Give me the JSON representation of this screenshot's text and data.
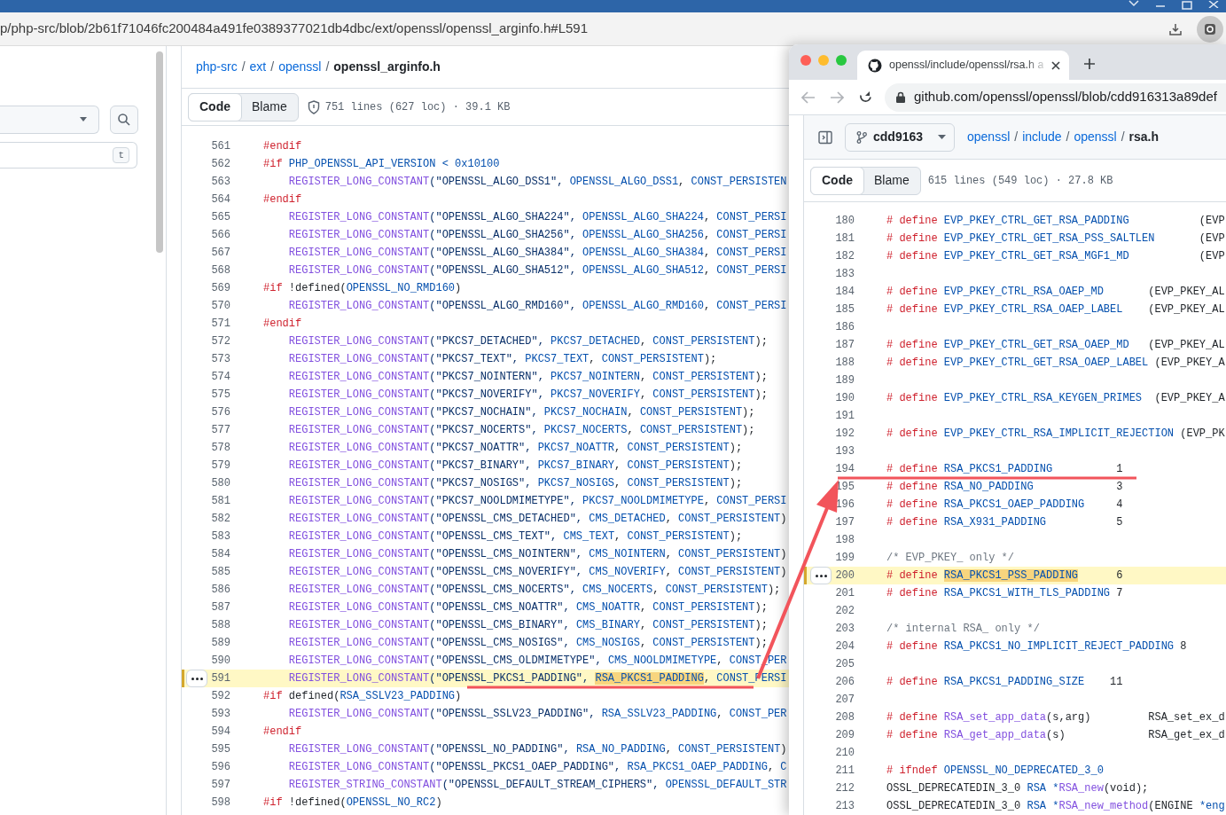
{
  "back_window": {
    "address": "p/php-src/blob/2b61f71046fc200484a491fe0389377021db4dbc/ext/openssl/openssl_arginfo.h#L591",
    "sidebar": {
      "shortcut_key": "t"
    },
    "breadcrumb": [
      {
        "kind": "link",
        "text": "php-src"
      },
      {
        "kind": "separator",
        "text": "/"
      },
      {
        "kind": "link",
        "text": "ext"
      },
      {
        "kind": "separator",
        "text": "/"
      },
      {
        "kind": "link",
        "text": "openssl"
      },
      {
        "kind": "separator",
        "text": "/"
      },
      {
        "kind": "current",
        "text": "openssl_arginfo.h"
      }
    ],
    "file_tabs": [
      {
        "label": "Code",
        "selected": true
      },
      {
        "label": "Blame",
        "selected": false
      }
    ],
    "file_info": "751 lines (627 loc) · 39.1 KB",
    "code_lines": [
      {
        "number": "561",
        "indented": false,
        "selected": false,
        "tokens": [
          {
            "kind": "kw",
            "text": "#endif"
          }
        ]
      },
      {
        "number": "562",
        "indented": false,
        "selected": false,
        "tokens": [
          {
            "kind": "kw",
            "text": "#if "
          },
          {
            "kind": "const",
            "text": "PHP_OPENSSL_API_VERSION < 0x10100"
          }
        ]
      },
      {
        "number": "563",
        "indented": true,
        "selected": false,
        "tokens": [
          {
            "kind": "fn",
            "text": "REGISTER_LONG_CONSTANT"
          },
          {
            "kind": "str",
            "text": "(\"OPENSSL_ALGO_DSS1\", "
          },
          {
            "kind": "const",
            "text": "OPENSSL_ALGO_DSS1"
          },
          {
            "kind": "plain",
            "text": ", "
          },
          {
            "kind": "const",
            "text": "CONST_PERSISTEN"
          }
        ]
      },
      {
        "number": "564",
        "indented": false,
        "selected": false,
        "tokens": [
          {
            "kind": "kw",
            "text": "#endif"
          }
        ]
      },
      {
        "number": "565",
        "indented": true,
        "selected": false,
        "tokens": [
          {
            "kind": "fn",
            "text": "REGISTER_LONG_CONSTANT"
          },
          {
            "kind": "str",
            "text": "(\"OPENSSL_ALGO_SHA224\", "
          },
          {
            "kind": "const",
            "text": "OPENSSL_ALGO_SHA224"
          },
          {
            "kind": "plain",
            "text": ", "
          },
          {
            "kind": "const",
            "text": "CONST_PERSI"
          }
        ]
      },
      {
        "number": "566",
        "indented": true,
        "selected": false,
        "tokens": [
          {
            "kind": "fn",
            "text": "REGISTER_LONG_CONSTANT"
          },
          {
            "kind": "str",
            "text": "(\"OPENSSL_ALGO_SHA256\", "
          },
          {
            "kind": "const",
            "text": "OPENSSL_ALGO_SHA256"
          },
          {
            "kind": "plain",
            "text": ", "
          },
          {
            "kind": "const",
            "text": "CONST_PERSI"
          }
        ]
      },
      {
        "number": "567",
        "indented": true,
        "selected": false,
        "tokens": [
          {
            "kind": "fn",
            "text": "REGISTER_LONG_CONSTANT"
          },
          {
            "kind": "str",
            "text": "(\"OPENSSL_ALGO_SHA384\", "
          },
          {
            "kind": "const",
            "text": "OPENSSL_ALGO_SHA384"
          },
          {
            "kind": "plain",
            "text": ", "
          },
          {
            "kind": "const",
            "text": "CONST_PERSI"
          }
        ]
      },
      {
        "number": "568",
        "indented": true,
        "selected": false,
        "tokens": [
          {
            "kind": "fn",
            "text": "REGISTER_LONG_CONSTANT"
          },
          {
            "kind": "str",
            "text": "(\"OPENSSL_ALGO_SHA512\", "
          },
          {
            "kind": "const",
            "text": "OPENSSL_ALGO_SHA512"
          },
          {
            "kind": "plain",
            "text": ", "
          },
          {
            "kind": "const",
            "text": "CONST_PERSI"
          }
        ]
      },
      {
        "number": "569",
        "indented": false,
        "selected": false,
        "tokens": [
          {
            "kind": "kw",
            "text": "#if"
          },
          {
            "kind": "plain",
            "text": " !defined("
          },
          {
            "kind": "const",
            "text": "OPENSSL_NO_RMD160"
          },
          {
            "kind": "plain",
            "text": ")"
          }
        ]
      },
      {
        "number": "570",
        "indented": true,
        "selected": false,
        "tokens": [
          {
            "kind": "fn",
            "text": "REGISTER_LONG_CONSTANT"
          },
          {
            "kind": "str",
            "text": "(\"OPENSSL_ALGO_RMD160\", "
          },
          {
            "kind": "const",
            "text": "OPENSSL_ALGO_RMD160"
          },
          {
            "kind": "plain",
            "text": ", "
          },
          {
            "kind": "const",
            "text": "CONST_PERSI"
          }
        ]
      },
      {
        "number": "571",
        "indented": false,
        "selected": false,
        "tokens": [
          {
            "kind": "kw",
            "text": "#endif"
          }
        ]
      },
      {
        "number": "572",
        "indented": true,
        "selected": false,
        "tokens": [
          {
            "kind": "fn",
            "text": "REGISTER_LONG_CONSTANT"
          },
          {
            "kind": "str",
            "text": "(\"PKCS7_DETACHED\", "
          },
          {
            "kind": "const",
            "text": "PKCS7_DETACHED"
          },
          {
            "kind": "plain",
            "text": ", "
          },
          {
            "kind": "const",
            "text": "CONST_PERSISTENT"
          },
          {
            "kind": "plain",
            "text": ");"
          }
        ]
      },
      {
        "number": "573",
        "indented": true,
        "selected": false,
        "tokens": [
          {
            "kind": "fn",
            "text": "REGISTER_LONG_CONSTANT"
          },
          {
            "kind": "str",
            "text": "(\"PKCS7_TEXT\", "
          },
          {
            "kind": "const",
            "text": "PKCS7_TEXT"
          },
          {
            "kind": "plain",
            "text": ", "
          },
          {
            "kind": "const",
            "text": "CONST_PERSISTENT"
          },
          {
            "kind": "plain",
            "text": ");"
          }
        ]
      },
      {
        "number": "574",
        "indented": true,
        "selected": false,
        "tokens": [
          {
            "kind": "fn",
            "text": "REGISTER_LONG_CONSTANT"
          },
          {
            "kind": "str",
            "text": "(\"PKCS7_NOINTERN\", "
          },
          {
            "kind": "const",
            "text": "PKCS7_NOINTERN"
          },
          {
            "kind": "plain",
            "text": ", "
          },
          {
            "kind": "const",
            "text": "CONST_PERSISTENT"
          },
          {
            "kind": "plain",
            "text": ");"
          }
        ]
      },
      {
        "number": "575",
        "indented": true,
        "selected": false,
        "tokens": [
          {
            "kind": "fn",
            "text": "REGISTER_LONG_CONSTANT"
          },
          {
            "kind": "str",
            "text": "(\"PKCS7_NOVERIFY\", "
          },
          {
            "kind": "const",
            "text": "PKCS7_NOVERIFY"
          },
          {
            "kind": "plain",
            "text": ", "
          },
          {
            "kind": "const",
            "text": "CONST_PERSISTENT"
          },
          {
            "kind": "plain",
            "text": ");"
          }
        ]
      },
      {
        "number": "576",
        "indented": true,
        "selected": false,
        "tokens": [
          {
            "kind": "fn",
            "text": "REGISTER_LONG_CONSTANT"
          },
          {
            "kind": "str",
            "text": "(\"PKCS7_NOCHAIN\", "
          },
          {
            "kind": "const",
            "text": "PKCS7_NOCHAIN"
          },
          {
            "kind": "plain",
            "text": ", "
          },
          {
            "kind": "const",
            "text": "CONST_PERSISTENT"
          },
          {
            "kind": "plain",
            "text": ");"
          }
        ]
      },
      {
        "number": "577",
        "indented": true,
        "selected": false,
        "tokens": [
          {
            "kind": "fn",
            "text": "REGISTER_LONG_CONSTANT"
          },
          {
            "kind": "str",
            "text": "(\"PKCS7_NOCERTS\", "
          },
          {
            "kind": "const",
            "text": "PKCS7_NOCERTS"
          },
          {
            "kind": "plain",
            "text": ", "
          },
          {
            "kind": "const",
            "text": "CONST_PERSISTENT"
          },
          {
            "kind": "plain",
            "text": ");"
          }
        ]
      },
      {
        "number": "578",
        "indented": true,
        "selected": false,
        "tokens": [
          {
            "kind": "fn",
            "text": "REGISTER_LONG_CONSTANT"
          },
          {
            "kind": "str",
            "text": "(\"PKCS7_NOATTR\", "
          },
          {
            "kind": "const",
            "text": "PKCS7_NOATTR"
          },
          {
            "kind": "plain",
            "text": ", "
          },
          {
            "kind": "const",
            "text": "CONST_PERSISTENT"
          },
          {
            "kind": "plain",
            "text": ");"
          }
        ]
      },
      {
        "number": "579",
        "indented": true,
        "selected": false,
        "tokens": [
          {
            "kind": "fn",
            "text": "REGISTER_LONG_CONSTANT"
          },
          {
            "kind": "str",
            "text": "(\"PKCS7_BINARY\", "
          },
          {
            "kind": "const",
            "text": "PKCS7_BINARY"
          },
          {
            "kind": "plain",
            "text": ", "
          },
          {
            "kind": "const",
            "text": "CONST_PERSISTENT"
          },
          {
            "kind": "plain",
            "text": ");"
          }
        ]
      },
      {
        "number": "580",
        "indented": true,
        "selected": false,
        "tokens": [
          {
            "kind": "fn",
            "text": "REGISTER_LONG_CONSTANT"
          },
          {
            "kind": "str",
            "text": "(\"PKCS7_NOSIGS\", "
          },
          {
            "kind": "const",
            "text": "PKCS7_NOSIGS"
          },
          {
            "kind": "plain",
            "text": ", "
          },
          {
            "kind": "const",
            "text": "CONST_PERSISTENT"
          },
          {
            "kind": "plain",
            "text": ");"
          }
        ]
      },
      {
        "number": "581",
        "indented": true,
        "selected": false,
        "tokens": [
          {
            "kind": "fn",
            "text": "REGISTER_LONG_CONSTANT"
          },
          {
            "kind": "str",
            "text": "(\"PKCS7_NOOLDMIMETYPE\", "
          },
          {
            "kind": "const",
            "text": "PKCS7_NOOLDMIMETYPE"
          },
          {
            "kind": "plain",
            "text": ", "
          },
          {
            "kind": "const",
            "text": "CONST_PERSI"
          }
        ]
      },
      {
        "number": "582",
        "indented": true,
        "selected": false,
        "tokens": [
          {
            "kind": "fn",
            "text": "REGISTER_LONG_CONSTANT"
          },
          {
            "kind": "str",
            "text": "(\"OPENSSL_CMS_DETACHED\", "
          },
          {
            "kind": "const",
            "text": "CMS_DETACHED"
          },
          {
            "kind": "plain",
            "text": ", "
          },
          {
            "kind": "const",
            "text": "CONST_PERSISTENT"
          },
          {
            "kind": "plain",
            "text": ")"
          }
        ]
      },
      {
        "number": "583",
        "indented": true,
        "selected": false,
        "tokens": [
          {
            "kind": "fn",
            "text": "REGISTER_LONG_CONSTANT"
          },
          {
            "kind": "str",
            "text": "(\"OPENSSL_CMS_TEXT\", "
          },
          {
            "kind": "const",
            "text": "CMS_TEXT"
          },
          {
            "kind": "plain",
            "text": ", "
          },
          {
            "kind": "const",
            "text": "CONST_PERSISTENT"
          },
          {
            "kind": "plain",
            "text": ");"
          }
        ]
      },
      {
        "number": "584",
        "indented": true,
        "selected": false,
        "tokens": [
          {
            "kind": "fn",
            "text": "REGISTER_LONG_CONSTANT"
          },
          {
            "kind": "str",
            "text": "(\"OPENSSL_CMS_NOINTERN\", "
          },
          {
            "kind": "const",
            "text": "CMS_NOINTERN"
          },
          {
            "kind": "plain",
            "text": ", "
          },
          {
            "kind": "const",
            "text": "CONST_PERSISTENT"
          },
          {
            "kind": "plain",
            "text": ")"
          }
        ]
      },
      {
        "number": "585",
        "indented": true,
        "selected": false,
        "tokens": [
          {
            "kind": "fn",
            "text": "REGISTER_LONG_CONSTANT"
          },
          {
            "kind": "str",
            "text": "(\"OPENSSL_CMS_NOVERIFY\", "
          },
          {
            "kind": "const",
            "text": "CMS_NOVERIFY"
          },
          {
            "kind": "plain",
            "text": ", "
          },
          {
            "kind": "const",
            "text": "CONST_PERSISTENT"
          },
          {
            "kind": "plain",
            "text": ")"
          }
        ]
      },
      {
        "number": "586",
        "indented": true,
        "selected": false,
        "tokens": [
          {
            "kind": "fn",
            "text": "REGISTER_LONG_CONSTANT"
          },
          {
            "kind": "str",
            "text": "(\"OPENSSL_CMS_NOCERTS\", "
          },
          {
            "kind": "const",
            "text": "CMS_NOCERTS"
          },
          {
            "kind": "plain",
            "text": ", "
          },
          {
            "kind": "const",
            "text": "CONST_PERSISTENT"
          },
          {
            "kind": "plain",
            "text": ");"
          }
        ]
      },
      {
        "number": "587",
        "indented": true,
        "selected": false,
        "tokens": [
          {
            "kind": "fn",
            "text": "REGISTER_LONG_CONSTANT"
          },
          {
            "kind": "str",
            "text": "(\"OPENSSL_CMS_NOATTR\", "
          },
          {
            "kind": "const",
            "text": "CMS_NOATTR"
          },
          {
            "kind": "plain",
            "text": ", "
          },
          {
            "kind": "const",
            "text": "CONST_PERSISTENT"
          },
          {
            "kind": "plain",
            "text": ");"
          }
        ]
      },
      {
        "number": "588",
        "indented": true,
        "selected": false,
        "tokens": [
          {
            "kind": "fn",
            "text": "REGISTER_LONG_CONSTANT"
          },
          {
            "kind": "str",
            "text": "(\"OPENSSL_CMS_BINARY\", "
          },
          {
            "kind": "const",
            "text": "CMS_BINARY"
          },
          {
            "kind": "plain",
            "text": ", "
          },
          {
            "kind": "const",
            "text": "CONST_PERSISTENT"
          },
          {
            "kind": "plain",
            "text": ");"
          }
        ]
      },
      {
        "number": "589",
        "indented": true,
        "selected": false,
        "tokens": [
          {
            "kind": "fn",
            "text": "REGISTER_LONG_CONSTANT"
          },
          {
            "kind": "str",
            "text": "(\"OPENSSL_CMS_NOSIGS\", "
          },
          {
            "kind": "const",
            "text": "CMS_NOSIGS"
          },
          {
            "kind": "plain",
            "text": ", "
          },
          {
            "kind": "const",
            "text": "CONST_PERSISTENT"
          },
          {
            "kind": "plain",
            "text": ");"
          }
        ]
      },
      {
        "number": "590",
        "indented": true,
        "selected": false,
        "tokens": [
          {
            "kind": "fn",
            "text": "REGISTER_LONG_CONSTANT"
          },
          {
            "kind": "str",
            "text": "(\"OPENSSL_CMS_OLDMIMETYPE\", "
          },
          {
            "kind": "const",
            "text": "CMS_NOOLDMIMETYPE"
          },
          {
            "kind": "plain",
            "text": ", "
          },
          {
            "kind": "const",
            "text": "CONST_PER"
          }
        ]
      },
      {
        "number": "591",
        "indented": true,
        "selected": true,
        "tokens": [
          {
            "kind": "fn",
            "text": "REGISTER_LONG_CONSTANT"
          },
          {
            "kind": "str",
            "text": "(\"OPENSSL_PKCS1_PADDING\", "
          },
          {
            "kind": "match",
            "text": "RSA_PKCS1_PADDING"
          },
          {
            "kind": "plain",
            "text": ", "
          },
          {
            "kind": "const",
            "text": "CONST_PERSI"
          }
        ]
      },
      {
        "number": "592",
        "indented": false,
        "selected": false,
        "tokens": [
          {
            "kind": "kw",
            "text": "#if"
          },
          {
            "kind": "plain",
            "text": " defined("
          },
          {
            "kind": "const",
            "text": "RSA_SSLV23_PADDING"
          },
          {
            "kind": "plain",
            "text": ")"
          }
        ]
      },
      {
        "number": "593",
        "indented": true,
        "selected": false,
        "tokens": [
          {
            "kind": "fn",
            "text": "REGISTER_LONG_CONSTANT"
          },
          {
            "kind": "str",
            "text": "(\"OPENSSL_SSLV23_PADDING\", "
          },
          {
            "kind": "const",
            "text": "RSA_SSLV23_PADDING"
          },
          {
            "kind": "plain",
            "text": ", "
          },
          {
            "kind": "const",
            "text": "CONST_PER"
          }
        ]
      },
      {
        "number": "594",
        "indented": false,
        "selected": false,
        "tokens": [
          {
            "kind": "kw",
            "text": "#endif"
          }
        ]
      },
      {
        "number": "595",
        "indented": true,
        "selected": false,
        "tokens": [
          {
            "kind": "fn",
            "text": "REGISTER_LONG_CONSTANT"
          },
          {
            "kind": "str",
            "text": "(\"OPENSSL_NO_PADDING\", "
          },
          {
            "kind": "const",
            "text": "RSA_NO_PADDING"
          },
          {
            "kind": "plain",
            "text": ", "
          },
          {
            "kind": "const",
            "text": "CONST_PERSISTENT"
          },
          {
            "kind": "plain",
            "text": ")"
          }
        ]
      },
      {
        "number": "596",
        "indented": true,
        "selected": false,
        "tokens": [
          {
            "kind": "fn",
            "text": "REGISTER_LONG_CONSTANT"
          },
          {
            "kind": "str",
            "text": "(\"OPENSSL_PKCS1_OAEP_PADDING\", "
          },
          {
            "kind": "const",
            "text": "RSA_PKCS1_OAEP_PADDING"
          },
          {
            "kind": "plain",
            "text": ", "
          },
          {
            "kind": "const",
            "text": "C"
          }
        ]
      },
      {
        "number": "597",
        "indented": true,
        "selected": false,
        "tokens": [
          {
            "kind": "fn",
            "text": "REGISTER_STRING_CONSTANT"
          },
          {
            "kind": "str",
            "text": "(\"OPENSSL_DEFAULT_STREAM_CIPHERS\", "
          },
          {
            "kind": "const",
            "text": "OPENSSL_DEFAULT_STR"
          }
        ]
      },
      {
        "number": "598",
        "indented": false,
        "selected": false,
        "tokens": [
          {
            "kind": "kw",
            "text": "#if"
          },
          {
            "kind": "plain",
            "text": " !defined("
          },
          {
            "kind": "const",
            "text": "OPENSSL_NO_RC2"
          },
          {
            "kind": "plain",
            "text": ")"
          }
        ]
      }
    ]
  },
  "front_window": {
    "tab_title": "openssl/include/openssl/rsa.h a",
    "address": "github.com/openssl/openssl/blob/cdd916313a89def",
    "branch": "cdd9163",
    "breadcrumb": [
      {
        "kind": "link",
        "text": "openssl"
      },
      {
        "kind": "separator",
        "text": "/"
      },
      {
        "kind": "link",
        "text": "include"
      },
      {
        "kind": "separator",
        "text": "/"
      },
      {
        "kind": "link",
        "text": "openssl"
      },
      {
        "kind": "separator",
        "text": "/"
      },
      {
        "kind": "current",
        "text": "rsa.h"
      }
    ],
    "file_tabs": [
      {
        "label": "Code",
        "selected": true
      },
      {
        "label": "Blame",
        "selected": false
      }
    ],
    "file_info": "615 lines (549 loc) · 27.8 KB",
    "code_lines": [
      {
        "number": "180",
        "selected": false,
        "tokens": [
          {
            "kind": "kw",
            "text": "# define "
          },
          {
            "kind": "const",
            "text": "EVP_PKEY_CTRL_GET_RSA_PADDING"
          },
          {
            "kind": "plain",
            "text": "           (EVP"
          }
        ]
      },
      {
        "number": "181",
        "selected": false,
        "tokens": [
          {
            "kind": "kw",
            "text": "# define "
          },
          {
            "kind": "const",
            "text": "EVP_PKEY_CTRL_GET_RSA_PSS_SALTLEN"
          },
          {
            "kind": "plain",
            "text": "       (EVP"
          }
        ]
      },
      {
        "number": "182",
        "selected": false,
        "tokens": [
          {
            "kind": "kw",
            "text": "# define "
          },
          {
            "kind": "const",
            "text": "EVP_PKEY_CTRL_GET_RSA_MGF1_MD"
          },
          {
            "kind": "plain",
            "text": "           (EVP"
          }
        ]
      },
      {
        "number": "183",
        "selected": false
      },
      {
        "number": "184",
        "selected": false,
        "tokens": [
          {
            "kind": "kw",
            "text": "# define "
          },
          {
            "kind": "const",
            "text": "EVP_PKEY_CTRL_RSA_OAEP_MD"
          },
          {
            "kind": "plain",
            "text": "       (EVP_PKEY_AL"
          }
        ]
      },
      {
        "number": "185",
        "selected": false,
        "tokens": [
          {
            "kind": "kw",
            "text": "# define "
          },
          {
            "kind": "const",
            "text": "EVP_PKEY_CTRL_RSA_OAEP_LABEL"
          },
          {
            "kind": "plain",
            "text": "    (EVP_PKEY_AL"
          }
        ]
      },
      {
        "number": "186",
        "selected": false
      },
      {
        "number": "187",
        "selected": false,
        "tokens": [
          {
            "kind": "kw",
            "text": "# define "
          },
          {
            "kind": "const",
            "text": "EVP_PKEY_CTRL_GET_RSA_OAEP_MD"
          },
          {
            "kind": "plain",
            "text": "   (EVP_PKEY_AL"
          }
        ]
      },
      {
        "number": "188",
        "selected": false,
        "tokens": [
          {
            "kind": "kw",
            "text": "# define "
          },
          {
            "kind": "const",
            "text": "EVP_PKEY_CTRL_GET_RSA_OAEP_LABEL"
          },
          {
            "kind": "plain",
            "text": " (EVP_PKEY_A"
          }
        ]
      },
      {
        "number": "189",
        "selected": false
      },
      {
        "number": "190",
        "selected": false,
        "tokens": [
          {
            "kind": "kw",
            "text": "# define "
          },
          {
            "kind": "const",
            "text": "EVP_PKEY_CTRL_RSA_KEYGEN_PRIMES"
          },
          {
            "kind": "plain",
            "text": "  (EVP_PKEY_A"
          }
        ]
      },
      {
        "number": "191",
        "selected": false
      },
      {
        "number": "192",
        "selected": false,
        "tokens": [
          {
            "kind": "kw",
            "text": "# define "
          },
          {
            "kind": "const",
            "text": "EVP_PKEY_CTRL_RSA_IMPLICIT_REJECTION"
          },
          {
            "kind": "plain",
            "text": " (EVP_PK"
          }
        ]
      },
      {
        "number": "193",
        "selected": false
      },
      {
        "number": "194",
        "selected": false,
        "tokens": [
          {
            "kind": "kw",
            "text": "# define "
          },
          {
            "kind": "const",
            "text": "RSA_PKCS1_PADDING"
          },
          {
            "kind": "plain",
            "text": "          1"
          }
        ]
      },
      {
        "number": "195",
        "selected": false,
        "tokens": [
          {
            "kind": "kw",
            "text": "# define "
          },
          {
            "kind": "const",
            "text": "RSA_NO_PADDING"
          },
          {
            "kind": "plain",
            "text": "             3"
          }
        ]
      },
      {
        "number": "196",
        "selected": false,
        "tokens": [
          {
            "kind": "kw",
            "text": "# define "
          },
          {
            "kind": "const",
            "text": "RSA_PKCS1_OAEP_PADDING"
          },
          {
            "kind": "plain",
            "text": "     4"
          }
        ]
      },
      {
        "number": "197",
        "selected": false,
        "tokens": [
          {
            "kind": "kw",
            "text": "# define "
          },
          {
            "kind": "const",
            "text": "RSA_X931_PADDING"
          },
          {
            "kind": "plain",
            "text": "           5"
          }
        ]
      },
      {
        "number": "198",
        "selected": false
      },
      {
        "number": "199",
        "selected": false,
        "tokens": [
          {
            "kind": "comment",
            "text": "/* EVP_PKEY_ only */"
          }
        ]
      },
      {
        "number": "200",
        "selected": true,
        "tokens": [
          {
            "kind": "kw",
            "text": "# define "
          },
          {
            "kind": "match",
            "text": "RSA_PKCS1_PSS_PADDING"
          },
          {
            "kind": "plain",
            "text": "      6"
          }
        ]
      },
      {
        "number": "201",
        "selected": false,
        "tokens": [
          {
            "kind": "kw",
            "text": "# define "
          },
          {
            "kind": "const",
            "text": "RSA_PKCS1_WITH_TLS_PADDING"
          },
          {
            "kind": "plain",
            "text": " 7"
          }
        ]
      },
      {
        "number": "202",
        "selected": false
      },
      {
        "number": "203",
        "selected": false,
        "tokens": [
          {
            "kind": "comment",
            "text": "/* internal RSA_ only */"
          }
        ]
      },
      {
        "number": "204",
        "selected": false,
        "tokens": [
          {
            "kind": "kw",
            "text": "# define "
          },
          {
            "kind": "const",
            "text": "RSA_PKCS1_NO_IMPLICIT_REJECT_PADDING"
          },
          {
            "kind": "plain",
            "text": " 8"
          }
        ]
      },
      {
        "number": "205",
        "selected": false
      },
      {
        "number": "206",
        "selected": false,
        "tokens": [
          {
            "kind": "kw",
            "text": "# define "
          },
          {
            "kind": "const",
            "text": "RSA_PKCS1_PADDING_SIZE"
          },
          {
            "kind": "plain",
            "text": "    11"
          }
        ]
      },
      {
        "number": "207",
        "selected": false
      },
      {
        "number": "208",
        "selected": false,
        "tokens": [
          {
            "kind": "kw",
            "text": "# define "
          },
          {
            "kind": "fn",
            "text": "RSA_set_app_data"
          },
          {
            "kind": "plain",
            "text": "(s,arg)         RSA_set_ex_d"
          }
        ]
      },
      {
        "number": "209",
        "selected": false,
        "tokens": [
          {
            "kind": "kw",
            "text": "# define "
          },
          {
            "kind": "fn",
            "text": "RSA_get_app_data"
          },
          {
            "kind": "plain",
            "text": "(s)             RSA_get_ex_d"
          }
        ]
      },
      {
        "number": "210",
        "selected": false
      },
      {
        "number": "211",
        "selected": false,
        "tokens": [
          {
            "kind": "kw",
            "text": "# ifndef "
          },
          {
            "kind": "const",
            "text": "OPENSSL_NO_DEPRECATED_3_0"
          }
        ]
      },
      {
        "number": "212",
        "selected": false,
        "tokens": [
          {
            "kind": "plain",
            "text": "OSSL_DEPRECATEDIN_3_0 "
          },
          {
            "kind": "const",
            "text": "RSA *"
          },
          {
            "kind": "fn",
            "text": "RSA_new"
          },
          {
            "kind": "plain",
            "text": "(void);"
          }
        ]
      },
      {
        "number": "213",
        "selected": false,
        "tokens": [
          {
            "kind": "plain",
            "text": "OSSL_DEPRECATEDIN_3_0 "
          },
          {
            "kind": "const",
            "text": "RSA *"
          },
          {
            "kind": "fn",
            "text": "RSA_new_method"
          },
          {
            "kind": "plain",
            "text": "(ENGINE "
          },
          {
            "kind": "const",
            "text": "*eng"
          }
        ]
      }
    ]
  }
}
